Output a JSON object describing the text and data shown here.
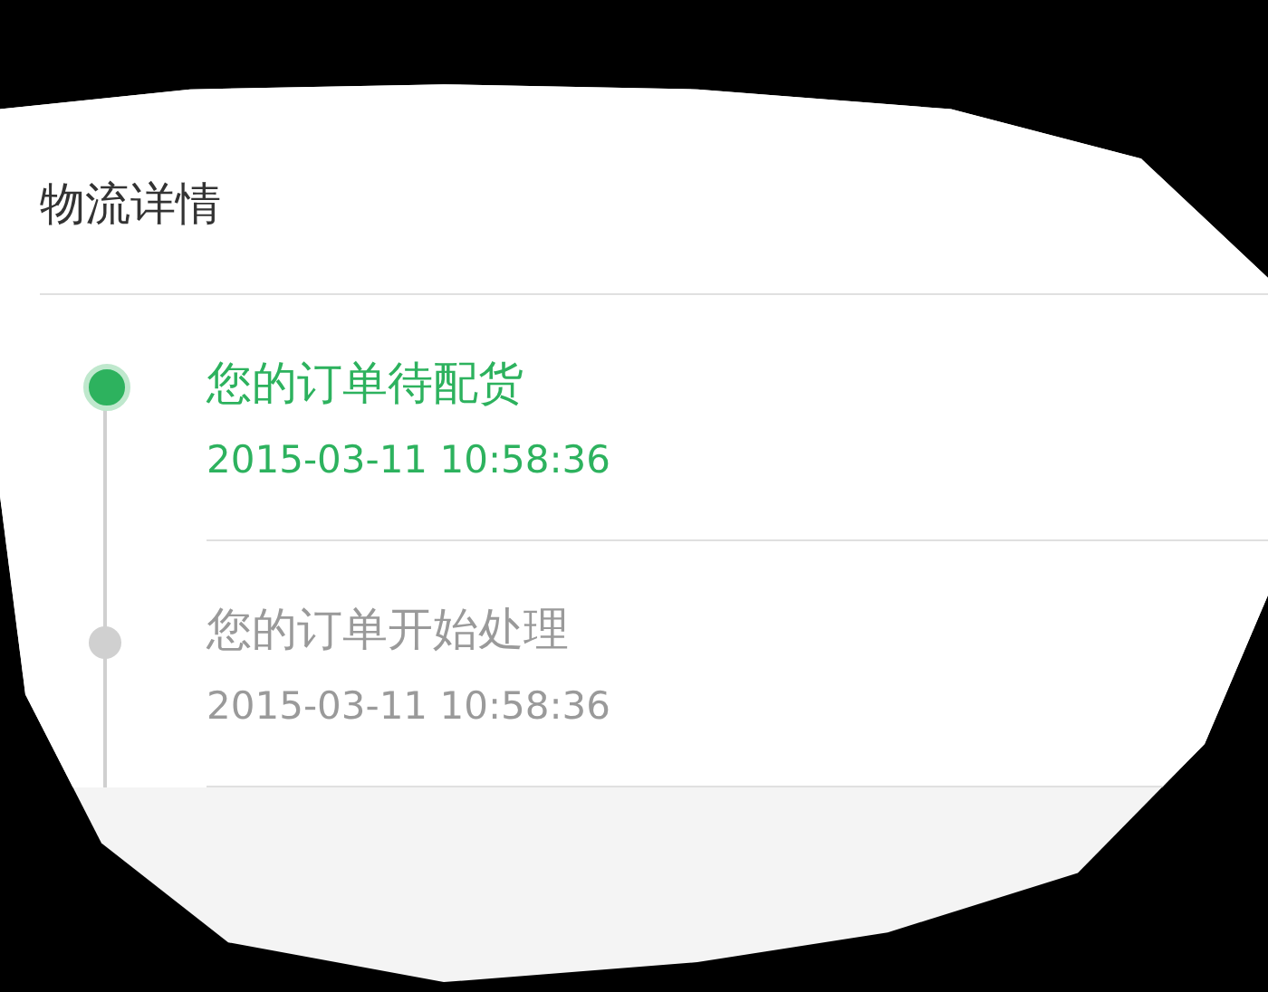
{
  "header": {
    "title": "物流详情"
  },
  "events": [
    {
      "title": "您的订单待配货",
      "time": "2015-03-11 10:58:36",
      "current": true
    },
    {
      "title": "您的订单开始处理",
      "time": "2015-03-11 10:58:36",
      "current": false
    }
  ]
}
